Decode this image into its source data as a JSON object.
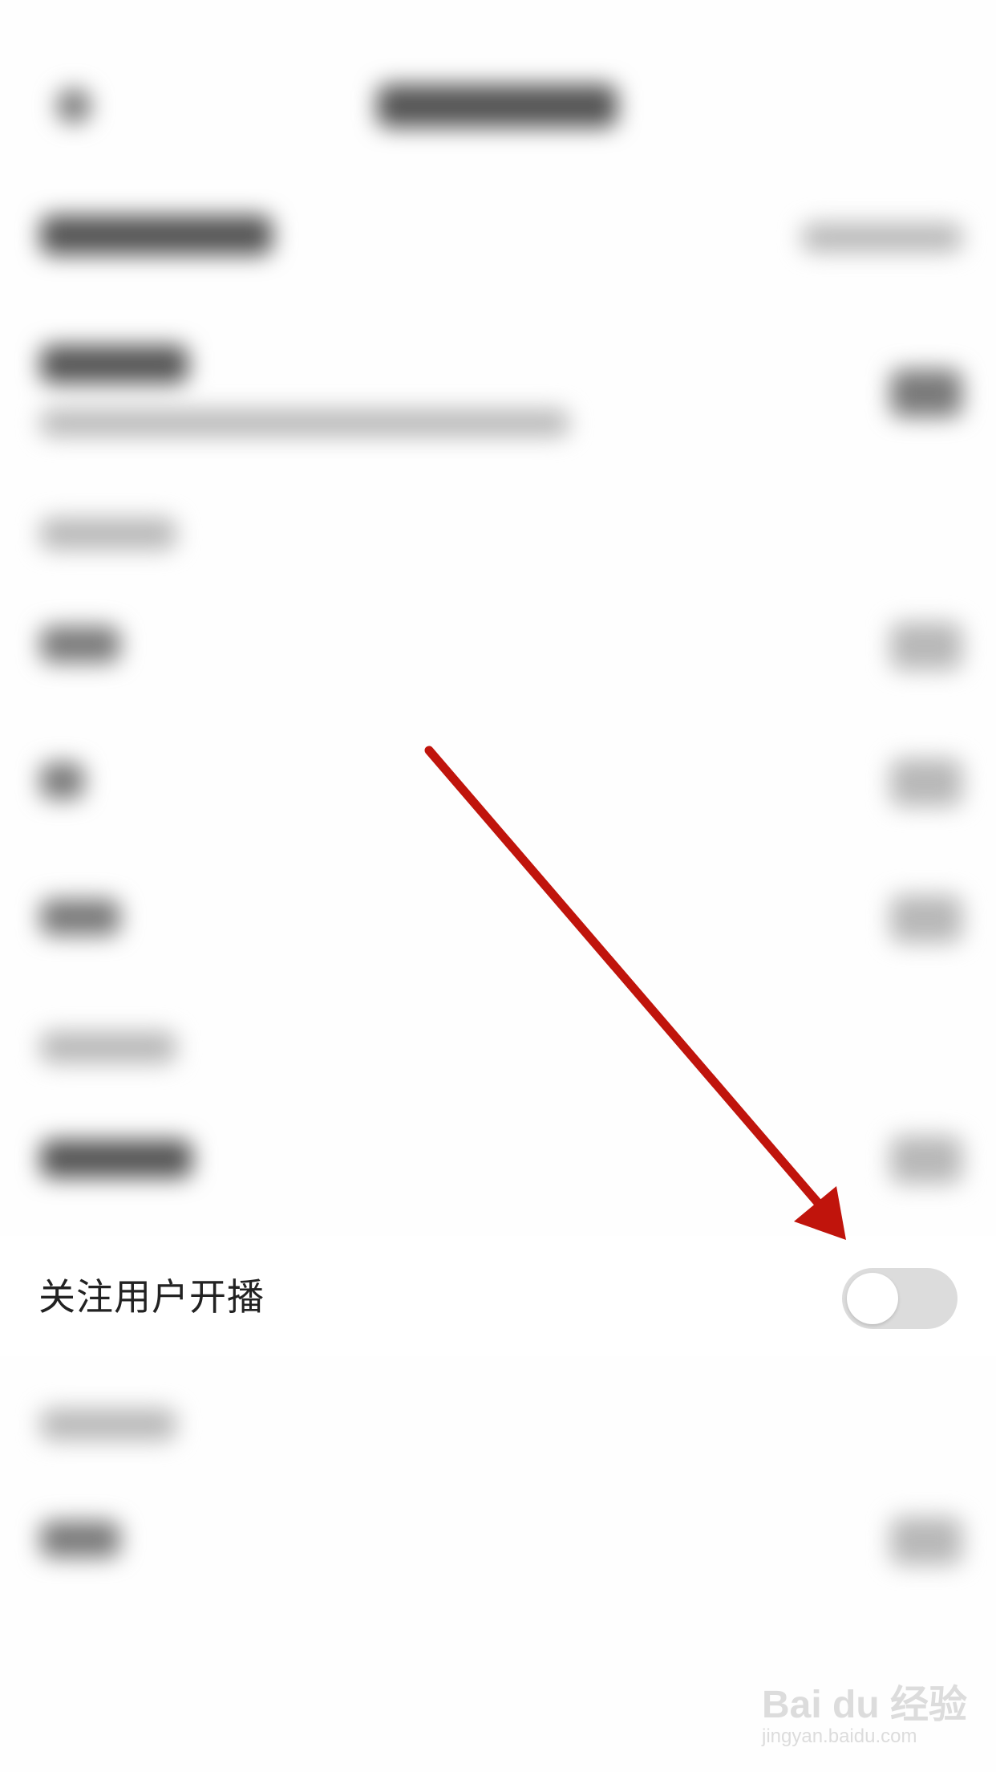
{
  "setting": {
    "label": "关注用户开播",
    "toggle_state": "off"
  },
  "colors": {
    "arrow": "#c0140c",
    "toggle_track_off": "#dcdcdc",
    "toggle_knob": "#ffffff",
    "label_text": "#222222"
  },
  "watermark": {
    "logo": "Bai du 经验",
    "url": "jingyan.baidu.com"
  }
}
